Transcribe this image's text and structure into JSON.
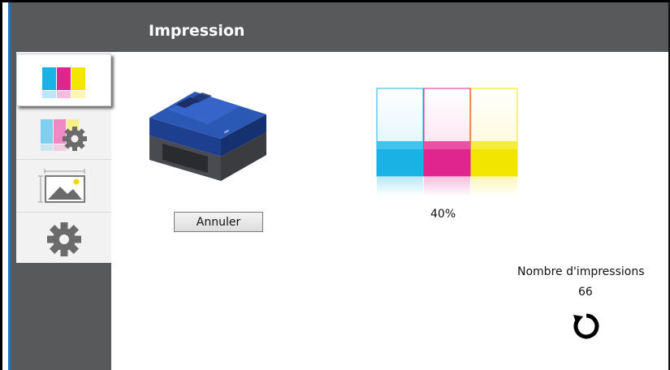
{
  "header": {
    "title": "Impression"
  },
  "sidebar": {
    "items": [
      {
        "name": "ink-status",
        "icon": "ink-bars-icon",
        "active": true
      },
      {
        "name": "ink-settings",
        "icon": "ink-gear-icon",
        "active": false
      },
      {
        "name": "image-settings",
        "icon": "image-icon",
        "active": false
      },
      {
        "name": "settings",
        "icon": "gear-icon",
        "active": false
      }
    ]
  },
  "main": {
    "cancel_label": "Annuler",
    "ink_level": "40%",
    "ink_colors": {
      "cyan": "#1ab2e4",
      "magenta": "#e0258f",
      "yellow": "#f2e600"
    },
    "print_count_label": "Nombre d'impressions",
    "print_count": "66"
  }
}
